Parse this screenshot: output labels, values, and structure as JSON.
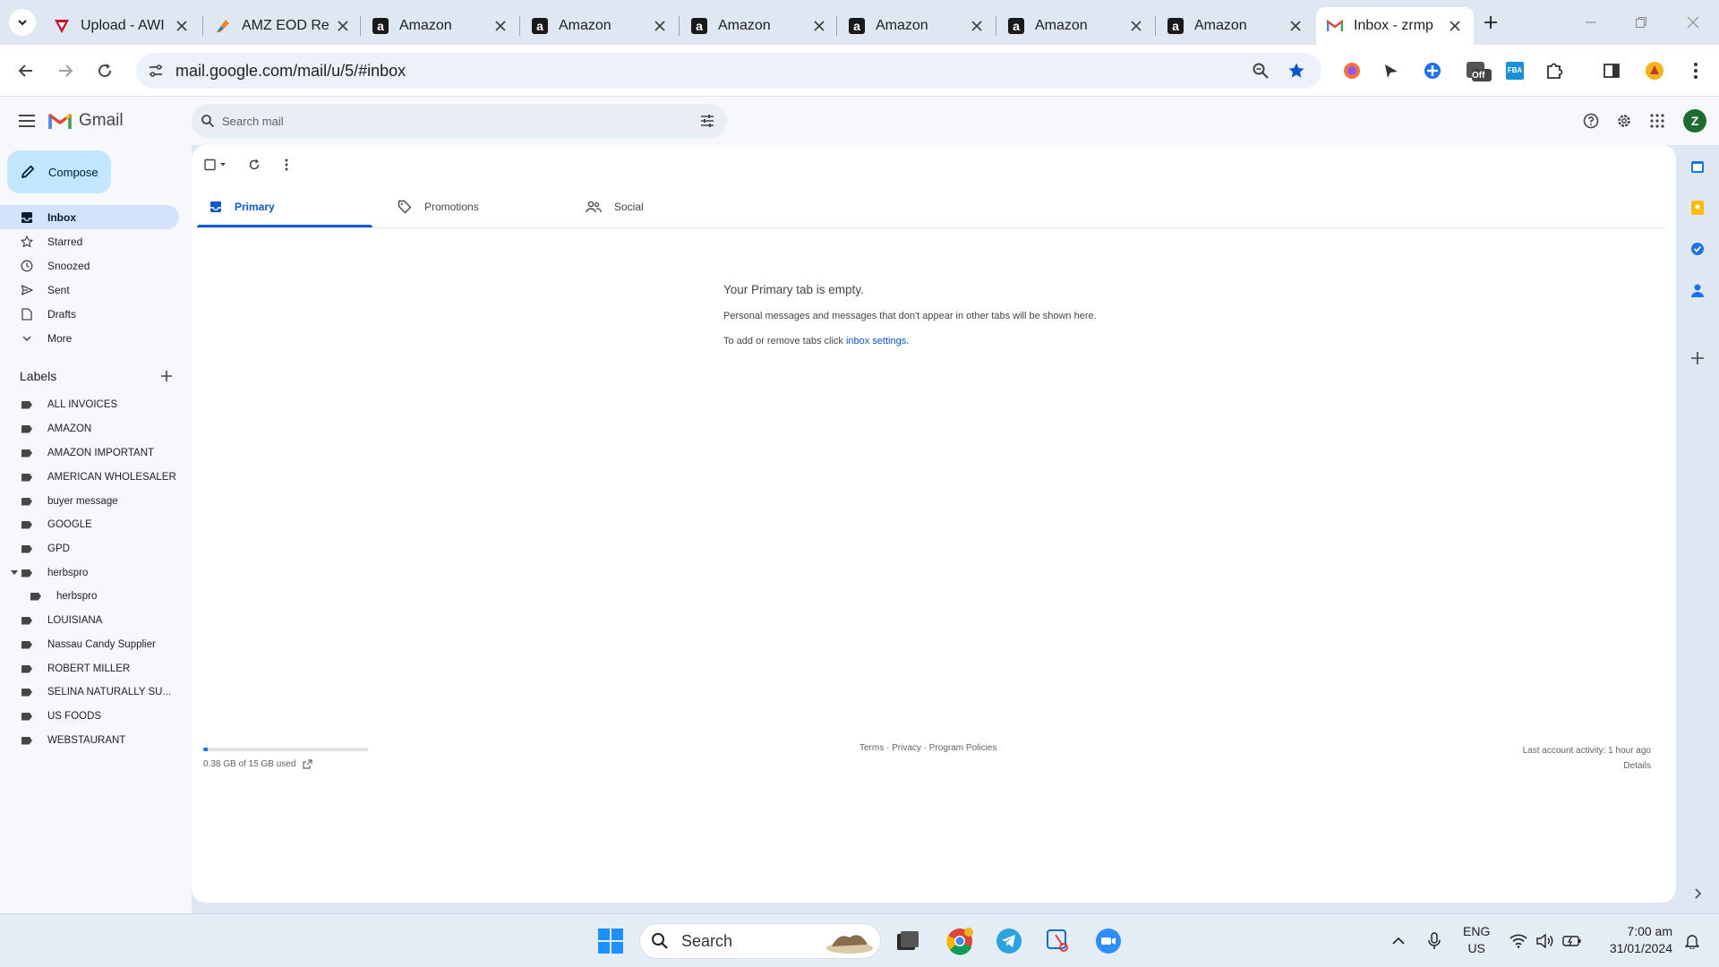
{
  "browser": {
    "tabs": [
      {
        "title": "Upload - AWI",
        "icon": "red-logo-icon"
      },
      {
        "title": "AMZ EOD Re",
        "icon": "zoho-logo-icon"
      },
      {
        "title": "Amazon",
        "icon": "amazon-logo-icon"
      },
      {
        "title": "Amazon",
        "icon": "amazon-logo-icon"
      },
      {
        "title": "Amazon",
        "icon": "amazon-logo-icon"
      },
      {
        "title": "Amazon",
        "icon": "amazon-logo-icon"
      },
      {
        "title": "Amazon",
        "icon": "amazon-logo-icon"
      },
      {
        "title": "Amazon",
        "icon": "amazon-logo-icon"
      },
      {
        "title": "Inbox - zrmp",
        "icon": "gmail-logo-icon",
        "active": true
      }
    ],
    "url": "mail.google.com/mail/u/5/#inbox",
    "extension_badge": "Off",
    "fba_badge": "FBA"
  },
  "gmail": {
    "app_name": "Gmail",
    "search_placeholder": "Search mail",
    "avatar_initial": "Z",
    "compose_label": "Compose",
    "nav": [
      {
        "label": "Inbox",
        "icon": "inbox-icon",
        "active": true
      },
      {
        "label": "Starred",
        "icon": "star-icon"
      },
      {
        "label": "Snoozed",
        "icon": "clock-icon"
      },
      {
        "label": "Sent",
        "icon": "send-icon"
      },
      {
        "label": "Drafts",
        "icon": "draft-icon"
      },
      {
        "label": "More",
        "icon": "chevron-down-icon"
      }
    ],
    "labels_title": "Labels",
    "labels": [
      {
        "name": "ALL INVOICES"
      },
      {
        "name": "AMAZON"
      },
      {
        "name": "AMAZON IMPORTANT"
      },
      {
        "name": "AMERICAN WHOLESALER"
      },
      {
        "name": "buyer message"
      },
      {
        "name": "GOOGLE"
      },
      {
        "name": "GPD"
      },
      {
        "name": "herbspro",
        "expanded": true
      },
      {
        "name": "herbspro",
        "nested": true
      },
      {
        "name": "LOUISIANA"
      },
      {
        "name": "Nassau Candy Supplier"
      },
      {
        "name": "ROBERT MILLER"
      },
      {
        "name": "SELINA NATURALLY SU..."
      },
      {
        "name": "US FOODS"
      },
      {
        "name": "WEBSTAURANT"
      }
    ],
    "categories": [
      {
        "label": "Primary",
        "icon": "inbox-icon",
        "active": true
      },
      {
        "label": "Promotions",
        "icon": "tag-icon"
      },
      {
        "label": "Social",
        "icon": "people-icon"
      }
    ],
    "empty_state": {
      "title": "Your Primary tab is empty.",
      "subtitle": "Personal messages and messages that don't appear in other tabs will be shown here.",
      "tip_prefix": "To add or remove tabs click ",
      "tip_link": "inbox settings",
      "tip_suffix": "."
    },
    "storage": {
      "text": "0.38 GB of 15 GB used",
      "fraction": 0.025
    },
    "footer": {
      "links": "Terms · Privacy · Program Policies"
    },
    "activity": {
      "text": "Last account activity: 1 hour ago",
      "details": "Details"
    }
  },
  "taskbar": {
    "search_label": "Search",
    "lang_line1": "ENG",
    "lang_line2": "US",
    "time": "7:00 am",
    "date": "31/01/2024"
  }
}
